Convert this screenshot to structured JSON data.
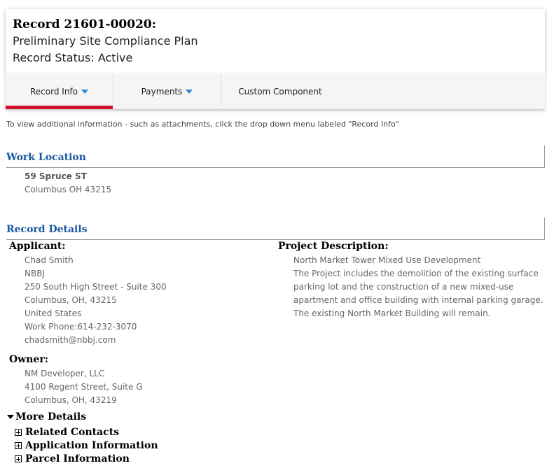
{
  "header": {
    "record_number": "Record 21601-00020:",
    "record_type": "Preliminary Site Compliance Plan",
    "record_status": "Record Status: Active"
  },
  "tabs": [
    {
      "label": "Record Info",
      "has_dropdown": true,
      "active": true
    },
    {
      "label": "Payments",
      "has_dropdown": true,
      "active": false
    },
    {
      "label": "Custom Component",
      "has_dropdown": false,
      "active": false
    }
  ],
  "hint_text": "To view additional information - such as attachments, click the drop down menu labeled \"Record Info\"",
  "work_location": {
    "title": "Work Location",
    "street": "59 Spruce ST",
    "city_line": "Columbus OH 43215"
  },
  "record_details": {
    "title": "Record Details",
    "applicant": {
      "label": "Applicant:",
      "lines": [
        "Chad Smith",
        "NBBJ",
        "250 South High Street - Suite 300",
        "Columbus, OH, 43215",
        "United States",
        "Work Phone:614-232-3070",
        "chadsmith@nbbj.com"
      ]
    },
    "owner": {
      "label": "Owner:",
      "lines": [
        "NM Developer, LLC",
        "4100 Regent Street, Suite G",
        "Columbus, OH, 43219"
      ]
    },
    "project_description": {
      "label": "Project Description:",
      "lines": [
        "North Market Tower Mixed Use Development",
        "The Project includes the demolition of the existing surface",
        "parking lot and the construction of a new mixed-use",
        "apartment and office building with internal parking garage.",
        "The existing North Market Building will remain."
      ]
    }
  },
  "more_details": {
    "label": "More Details",
    "items": [
      "Related Contacts",
      "Application Information",
      "Parcel Information"
    ]
  },
  "colors": {
    "section_title": "#1b5aa0",
    "active_tab_bar": "#d0102c",
    "caret": "#2b8bd8"
  }
}
